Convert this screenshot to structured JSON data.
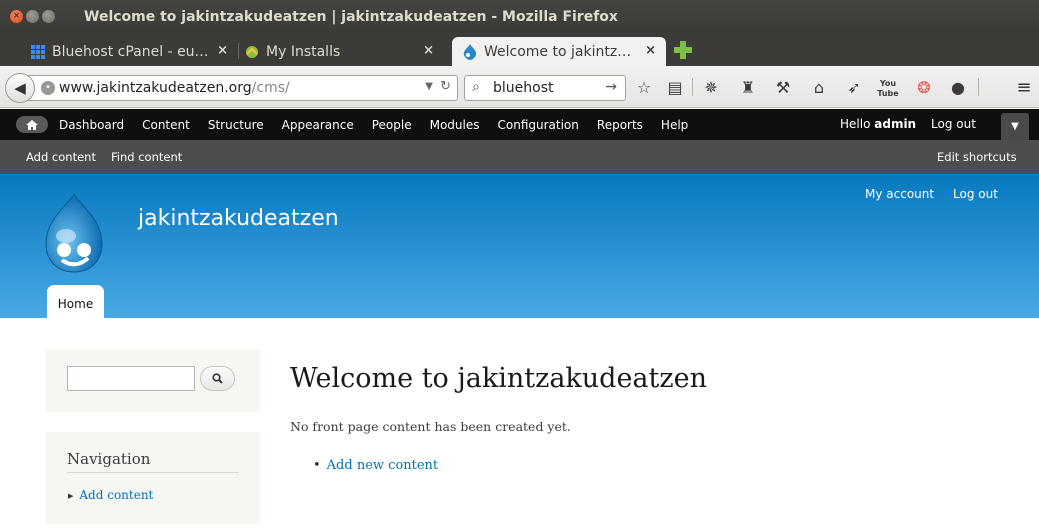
{
  "window": {
    "title": "Welcome to jakintzakudeatzen | jakintzakudeatzen - Mozilla Firefox"
  },
  "tabs": [
    {
      "label": "Bluehost cPanel - eu…",
      "icon": "cpanel-grid-icon"
    },
    {
      "label": "My Installs",
      "icon": "installs-icon"
    },
    {
      "label": "Welcome to jakintz…",
      "icon": "drupal-icon",
      "active": true
    }
  ],
  "navbar": {
    "url_host": "www.jakintzakudeatzen.org",
    "url_path": "/cms/",
    "search_value": "bluehost",
    "icons": [
      "bookmark-star-icon",
      "reading-list-icon",
      "addon-gear-icon",
      "puzzle-icon",
      "wrench-icon",
      "home-icon",
      "send-icon",
      "youtube-icon",
      "lifebuoy-icon",
      "chat-icon",
      "menu-icon"
    ]
  },
  "admin": {
    "menu": [
      "Dashboard",
      "Content",
      "Structure",
      "Appearance",
      "People",
      "Modules",
      "Configuration",
      "Reports",
      "Help"
    ],
    "hello": "Hello",
    "user": "admin",
    "logout": "Log out"
  },
  "shortcuts": {
    "add_content": "Add content",
    "find_content": "Find content",
    "edit": "Edit shortcuts"
  },
  "site": {
    "name": "jakintzakudeatzen",
    "my_account": "My account",
    "logout": "Log out",
    "home_tab": "Home"
  },
  "sidebar": {
    "nav_title": "Navigation",
    "nav_item": "Add content"
  },
  "main": {
    "title": "Welcome to jakintzakudeatzen",
    "message": "No front page content has been created yet.",
    "link": "Add new content"
  },
  "colors": {
    "header_top": "#0779bf",
    "header_bottom": "#48a9e4",
    "link": "#0071b3",
    "admin_bar": "#0f0f0f",
    "shortcut_bar": "#4d4d4d"
  }
}
